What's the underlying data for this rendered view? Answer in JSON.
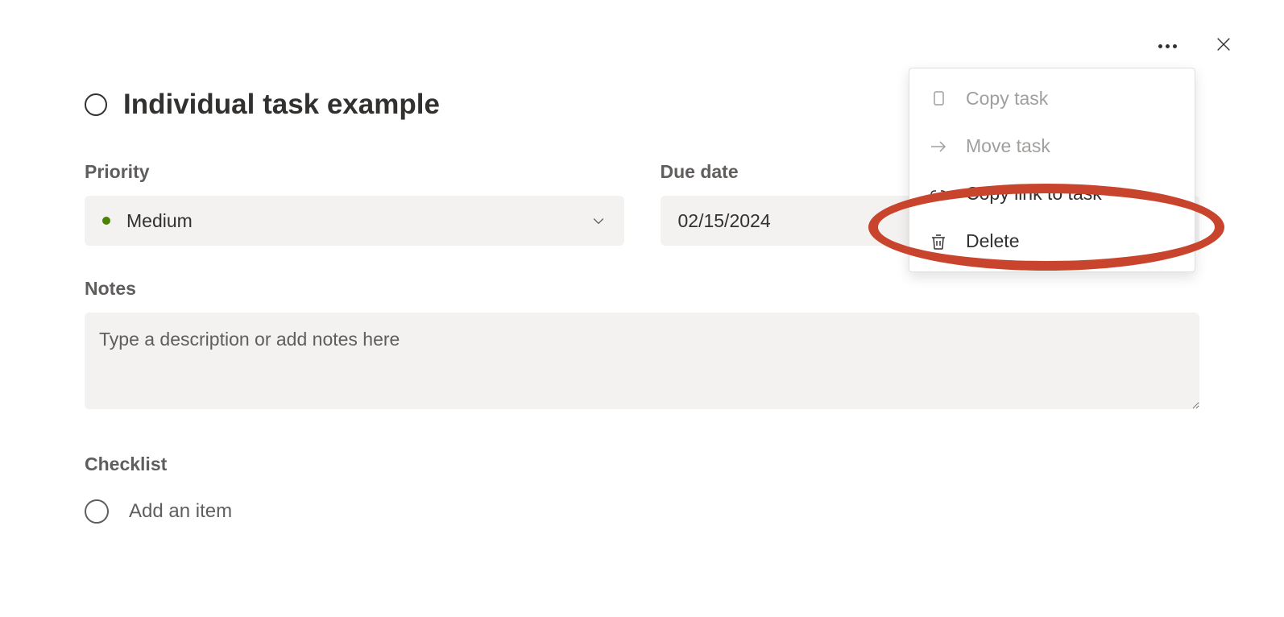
{
  "task": {
    "title": "Individual task example"
  },
  "fields": {
    "priority": {
      "label": "Priority",
      "value": "Medium",
      "color": "#498205"
    },
    "dueDate": {
      "label": "Due date",
      "value": "02/15/2024"
    },
    "notes": {
      "label": "Notes",
      "placeholder": "Type a description or add notes here"
    },
    "checklist": {
      "label": "Checklist",
      "addText": "Add an item"
    }
  },
  "menu": {
    "items": [
      {
        "label": "Copy task",
        "icon": "copy",
        "disabled": true
      },
      {
        "label": "Move task",
        "icon": "arrow-right",
        "disabled": true
      },
      {
        "label": "Copy link to task",
        "icon": "link",
        "disabled": false,
        "highlighted": true
      },
      {
        "label": "Delete",
        "icon": "trash",
        "disabled": false
      }
    ]
  }
}
